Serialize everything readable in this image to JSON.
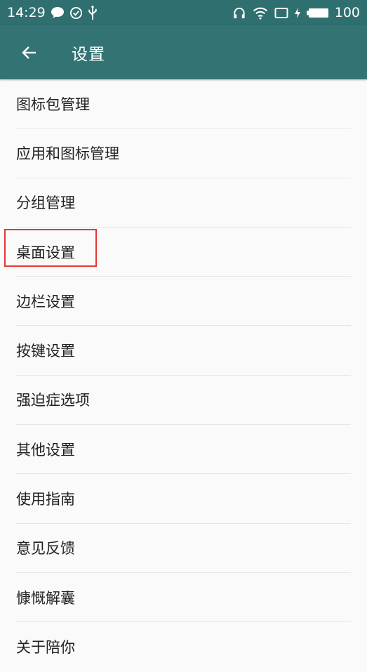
{
  "status_bar": {
    "time": "14:29",
    "battery_level": "100",
    "left_icons": [
      "chat-bubble-icon",
      "check-circle-icon",
      "usb-icon"
    ],
    "right_icons": [
      "headphones-icon",
      "wifi-icon",
      "screen-rotate-icon",
      "charging-icon",
      "battery-icon"
    ]
  },
  "app_bar": {
    "title": "设置",
    "back_icon": "arrow-back-icon"
  },
  "settings": {
    "items": [
      {
        "label": "图标包管理"
      },
      {
        "label": "应用和图标管理"
      },
      {
        "label": "分组管理"
      },
      {
        "label": "桌面设置",
        "highlighted": true
      },
      {
        "label": "边栏设置"
      },
      {
        "label": "按键设置"
      },
      {
        "label": "强迫症选项"
      },
      {
        "label": "其他设置"
      },
      {
        "label": "使用指南"
      },
      {
        "label": "意见反馈"
      },
      {
        "label": "慷慨解囊"
      },
      {
        "label": "关于陪你"
      }
    ]
  },
  "colors": {
    "status_bar": "#2f6f6f",
    "app_bar": "#337373",
    "background": "#fafafa",
    "highlight": "#e53935"
  }
}
